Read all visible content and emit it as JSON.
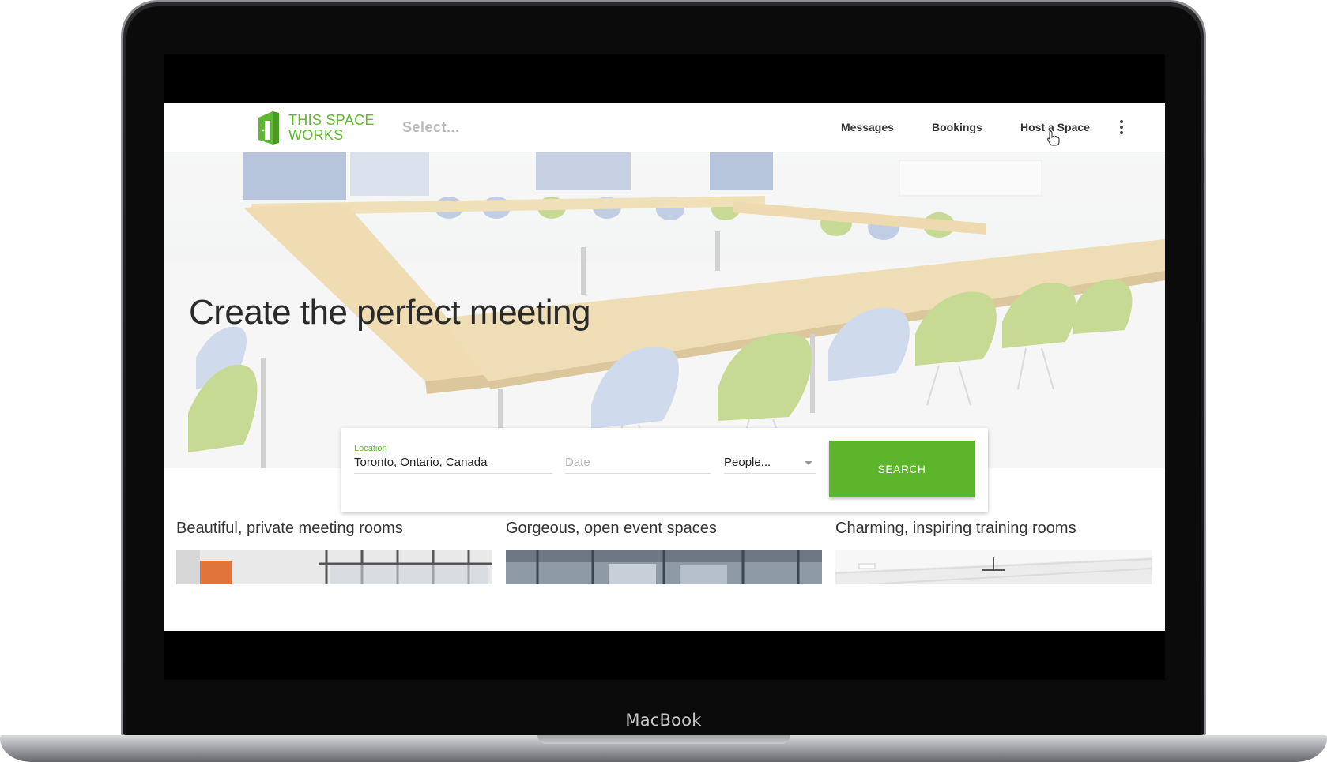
{
  "device": {
    "brand_label": "MacBook"
  },
  "header": {
    "logo_line1": "THIS SPACE",
    "logo_line2": "WORKS",
    "select_placeholder": "Select...",
    "nav": {
      "messages": "Messages",
      "bookings": "Bookings",
      "host": "Host a Space"
    },
    "menu_icon": "kebab-menu-icon"
  },
  "hero": {
    "title": "Create the perfect meeting"
  },
  "search": {
    "location_label": "Location",
    "location_value": "Toronto, Ontario, Canada",
    "date_placeholder": "Date",
    "people_value": "People...",
    "button_label": "SEARCH"
  },
  "categories": [
    {
      "title": "Beautiful, private meeting rooms"
    },
    {
      "title": "Gorgeous, open event spaces"
    },
    {
      "title": "Charming, inspiring training rooms"
    }
  ],
  "colors": {
    "brand_green": "#5cb52a",
    "logo_green": "#5fb832",
    "text_dark": "#333333"
  }
}
